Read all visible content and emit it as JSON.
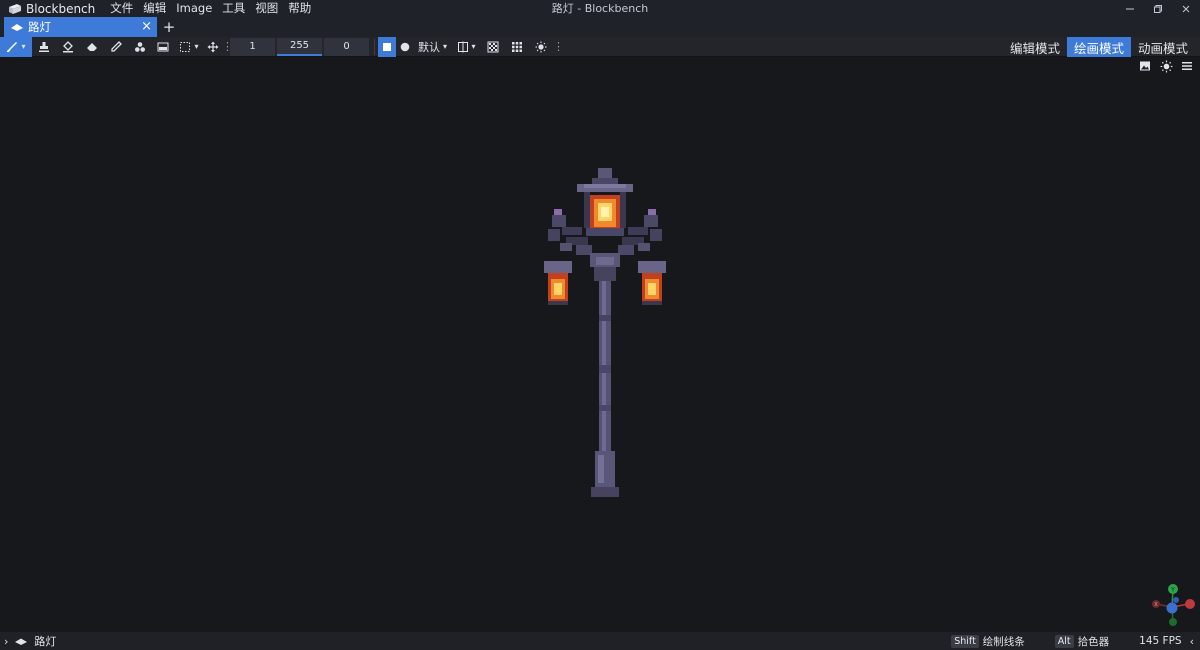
{
  "app": {
    "name": "Blockbench",
    "window_title": "路灯 - Blockbench"
  },
  "menu": [
    "文件",
    "编辑",
    "Image",
    "工具",
    "视图",
    "帮助"
  ],
  "window_controls": [
    "minimize-icon",
    "restore-icon",
    "close-icon"
  ],
  "tabs": [
    {
      "label": "路灯",
      "active": true
    }
  ],
  "toolbar": {
    "brush_size": "1",
    "opacity": "255",
    "softness": "0",
    "blend_mode": "默认",
    "tools": [
      "brush-icon",
      "stamp-icon",
      "fill-bucket-icon",
      "eraser-icon",
      "color-picker-icon",
      "shape-icon",
      "gradient-icon",
      "selection-icon",
      "move-icon"
    ]
  },
  "modes": [
    {
      "label": "编辑模式",
      "active": false
    },
    {
      "label": "绘画模式",
      "active": true
    },
    {
      "label": "动画模式",
      "active": false
    }
  ],
  "viewport_icons": [
    "image-icon",
    "brightness-icon",
    "menu-icon"
  ],
  "statusbar": {
    "model_name": "路灯",
    "hints": [
      {
        "key": "Shift",
        "label": "绘制线条"
      },
      {
        "key": "Alt",
        "label": "拾色器"
      }
    ],
    "fps": "145 FPS"
  },
  "colors": {
    "accent": "#3e7bd9",
    "background": "#17181c",
    "header": "#202229"
  }
}
